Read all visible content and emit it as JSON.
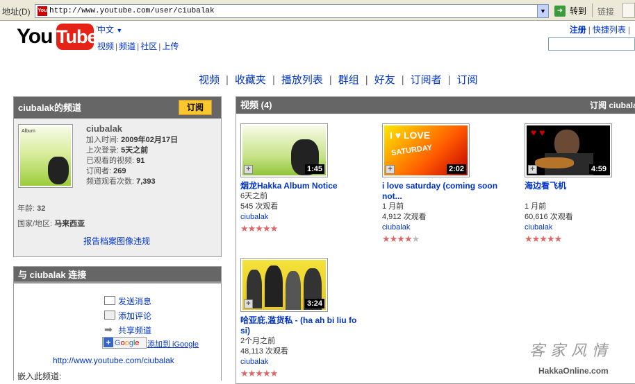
{
  "browser": {
    "address_label": "地址(D)",
    "url": "http://www.youtube.com/user/ciubalak",
    "go_label": "转到",
    "links_label": "链接"
  },
  "header": {
    "logo_you": "You",
    "logo_tube": "Tube",
    "language": "中文",
    "nav": [
      "视频",
      "频道",
      "社区",
      "上传"
    ],
    "signup": "注册",
    "quicklist": "快捷列表"
  },
  "channel_nav": [
    "视频",
    "收藏夹",
    "播放列表",
    "群组",
    "好友",
    "订阅者",
    "订阅"
  ],
  "channel_box": {
    "title": "ciubalak的频道",
    "subscribe_label": "订阅",
    "username": "ciubalak",
    "joined_label": "加入时间:",
    "joined_value": "2009年02月17日",
    "last_login_label": "上次登录:",
    "last_login_value": "5天之前",
    "videos_watched_label": "已观看的视频:",
    "videos_watched_value": "91",
    "subscribers_label": "订阅者:",
    "subscribers_value": "269",
    "channel_views_label": "频道观看次数:",
    "channel_views_value": "7,393",
    "age_label": "年龄:",
    "age_value": "32",
    "country_label": "国家/地区:",
    "country_value": "马来西亚",
    "report_label": "报告档案图像违规"
  },
  "connect_box": {
    "title": "与 ciubalak 连接",
    "send_message": "发送消息",
    "add_comment": "添加评论",
    "share_channel": "共享频道",
    "add_to_google": "添加到 iGoogle",
    "channel_url": "http://www.youtube.com/ciubalak",
    "embed_label": "嵌入此频道:"
  },
  "videos_box": {
    "title": "视频 (4)",
    "right_label": "订阅 ciubala",
    "items": [
      {
        "title": "烟龙Hakka Album Notice",
        "age": "6天之前",
        "views": "545 次观看",
        "user": "ciubalak",
        "duration": "1:45",
        "rating": 5
      },
      {
        "title": "i love saturday (coming soon not...",
        "age": "1 月前",
        "views": "4,912 次观看",
        "user": "ciubalak",
        "duration": "2:02",
        "rating": 4.5
      },
      {
        "title": "海边看飞机",
        "age": "1 月前",
        "views": "60,616 次观看",
        "user": "ciubalak",
        "duration": "4:59",
        "rating": 5
      },
      {
        "title": "哈亚庇,滥货私 - (ha ah bi liu fo si)",
        "age": "2个月之前",
        "views": "48,113 次观看",
        "user": "ciubalak",
        "duration": "3:24",
        "rating": 5
      }
    ]
  },
  "watermark": {
    "text": "客家风情",
    "url": "HakkaOnline.com"
  },
  "colors": {
    "link": "#0033cc",
    "panel_header": "#666666",
    "subscribe_button": "#fbc72e",
    "logo_red": "#e62117",
    "star": "#dd6666"
  }
}
